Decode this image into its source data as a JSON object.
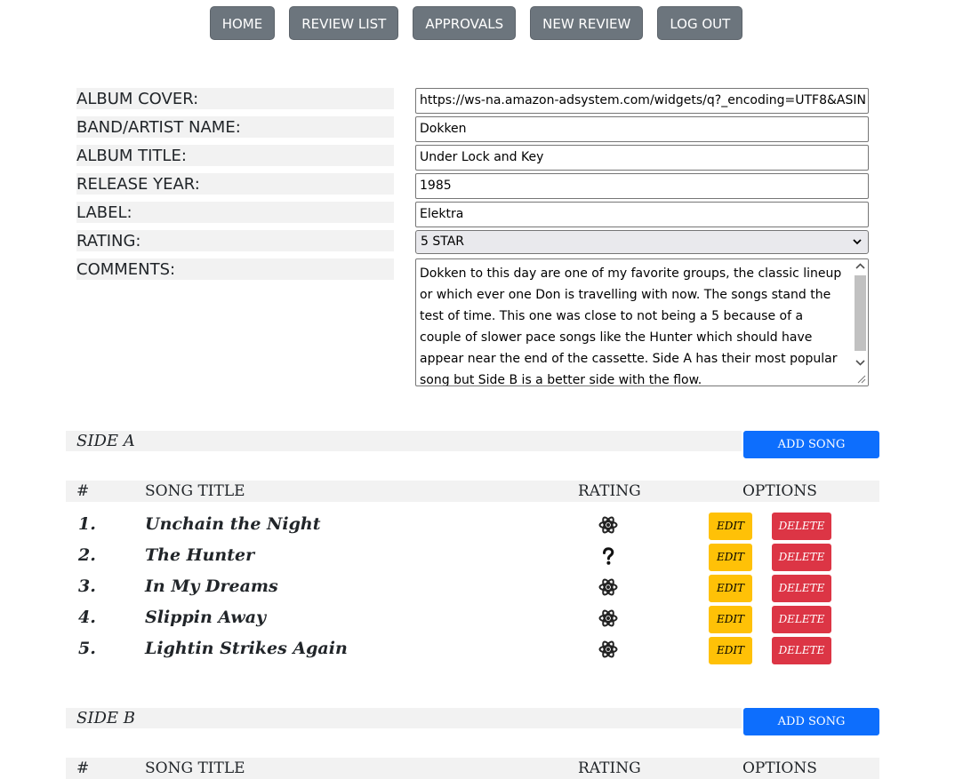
{
  "nav": {
    "items": [
      "HOME",
      "REVIEW LIST",
      "APPROVALS",
      "NEW REVIEW",
      "LOG OUT"
    ]
  },
  "form": {
    "album_cover": {
      "label": "ALBUM COVER:",
      "value": "https://ws-na.amazon-adsystem.com/widgets/q?_encoding=UTF8&ASIN"
    },
    "band_artist": {
      "label": "BAND/ARTIST NAME:",
      "value": "Dokken"
    },
    "album_title": {
      "label": "ALBUM TITLE:",
      "value": "Under Lock and Key"
    },
    "release_year": {
      "label": "RELEASE YEAR:",
      "value": "1985"
    },
    "label": {
      "label": "LABEL:",
      "value": "Elektra"
    },
    "rating": {
      "label": "RATING:",
      "value": "5 STAR"
    },
    "comments": {
      "label": "COMMENTS:",
      "value": "Dokken to this day are one of my favorite groups, the classic lineup or which ever one Don is travelling with now.  The songs stand the test of time.  This one was close to not being a 5 because of a couple of slower pace songs like the Hunter which should have appear near the end of the cassette.  Side A has their most popular song but Side B is a better side with the flow."
    }
  },
  "side_a": {
    "title": "SIDE A",
    "add_song_label": "ADD SONG",
    "columns": {
      "num": "#",
      "title": "SONG TITLE",
      "rating": "RATING",
      "options": "OPTIONS"
    },
    "edit_label": "EDIT",
    "delete_label": "DELETE",
    "songs": [
      {
        "num": "1.",
        "title": "Unchain the Night",
        "rating_icon": "atom-icon"
      },
      {
        "num": "2.",
        "title": "The Hunter",
        "rating_icon": "question-mark-icon"
      },
      {
        "num": "3.",
        "title": "In My Dreams",
        "rating_icon": "atom-icon"
      },
      {
        "num": "4.",
        "title": "Slippin Away",
        "rating_icon": "atom-icon"
      },
      {
        "num": "5.",
        "title": "Lightin Strikes Again",
        "rating_icon": "atom-icon"
      }
    ]
  },
  "side_b": {
    "title": "SIDE B",
    "add_song_label": "ADD SONG",
    "columns": {
      "num": "#",
      "title": "SONG TITLE",
      "rating": "RATING",
      "options": "OPTIONS"
    }
  },
  "colors": {
    "nav_button": "#6c757d",
    "primary": "#0d6efd",
    "warning": "#ffc107",
    "danger": "#dc3545",
    "label_background": "#f2f2f2"
  }
}
